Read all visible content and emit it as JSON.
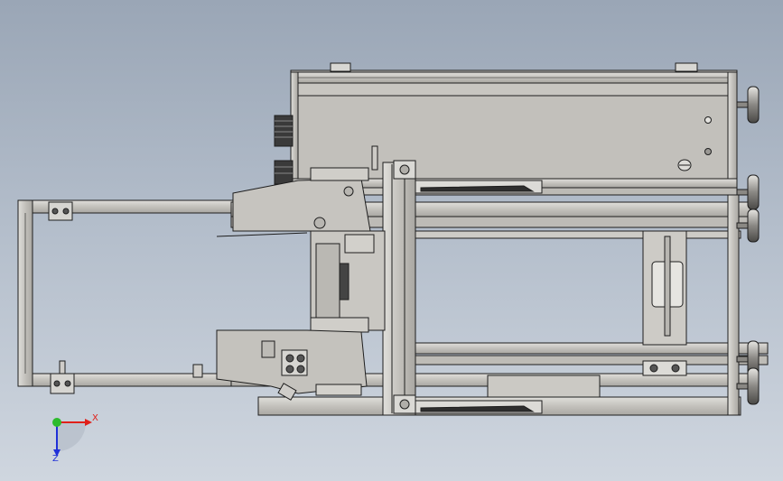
{
  "viewport": {
    "view": "top",
    "background": [
      "#9aa6b6",
      "#cfd6df"
    ]
  },
  "model": {
    "part_color": "#c8c6c1",
    "edge_color": "#1e1e1e",
    "shade_color": "#9e9c97"
  },
  "triad": {
    "x_label": "X",
    "z_label": "Z",
    "x_color": "#e0201a",
    "y_color": "#2dbb2d",
    "z_color": "#2030d8"
  }
}
